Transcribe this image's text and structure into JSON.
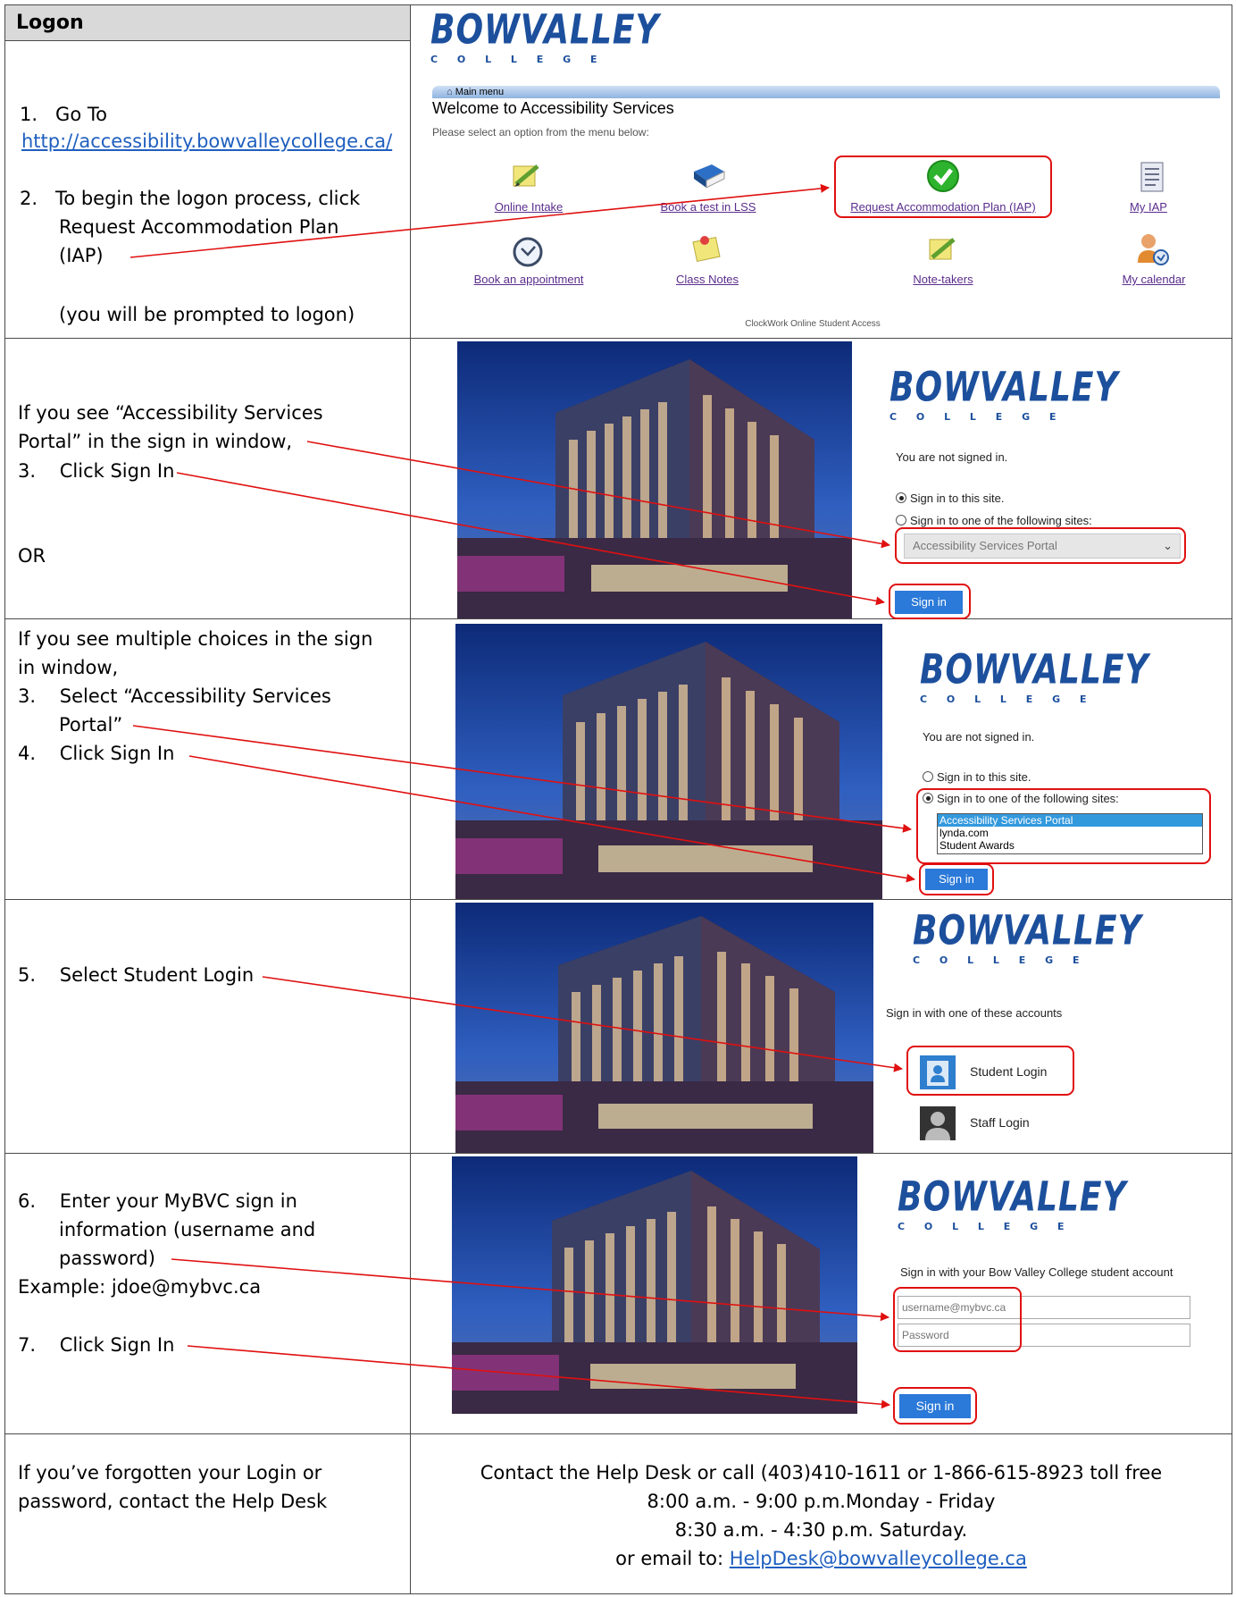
{
  "header": {
    "title": "Logon"
  },
  "logo": {
    "main": "BOWVALLEY",
    "sub": "C O L L E G E"
  },
  "row1": {
    "step1_label": "1.   Go To",
    "step1_link": "http://accessibility.bowvalleycollege.ca/",
    "step2_line1": "2.   To begin the logon process, click",
    "step2_line2": "Request Accommodation Plan",
    "step2_line3": "(IAP)",
    "prompt_note": "(you will be prompted to  logon)"
  },
  "clockwork": {
    "menu_tab": "Main menu",
    "heading": "Welcome to Accessibility Services",
    "subtitle": "Please select an option from the menu below:",
    "items": [
      {
        "label": "Online Intake",
        "icon": "pencil-note-icon"
      },
      {
        "label": "Book a test in LSS",
        "icon": "book-icon"
      },
      {
        "label": "Request Accommodation Plan (IAP)",
        "icon": "green-check-icon"
      },
      {
        "label": "My IAP",
        "icon": "document-icon"
      },
      {
        "label": "Book an appointment",
        "icon": "clock-icon"
      },
      {
        "label": "Class Notes",
        "icon": "notes-pin-icon"
      },
      {
        "label": "Note-takers",
        "icon": "pencil-note-icon"
      },
      {
        "label": "My calendar",
        "icon": "person-calendar-icon"
      }
    ],
    "footer": "ClockWork Online Student Access"
  },
  "row2": {
    "line1": "If you see “Accessibility Services",
    "line2": "Portal” in the sign in window,",
    "line3": "3.    Click Sign In",
    "or": "OR",
    "not_signed": "You are not signed in.",
    "opt1": "Sign in to this site.",
    "opt2": "Sign in to one of the following sites:",
    "select_value": "Accessibility Services Portal",
    "button": "Sign in"
  },
  "row3": {
    "line1": "If you see multiple choices in the sign",
    "line2": "in window,",
    "line3": "3.    Select “Accessibility Services",
    "line4": "Portal”",
    "line5": "4.    Click Sign In",
    "not_signed": "You are not signed in.",
    "opt1": "Sign in to this site.",
    "opt2": "Sign in to one of the following sites:",
    "list": [
      "Accessibility Services Portal",
      "lynda.com",
      "Student Awards"
    ],
    "button": "Sign in"
  },
  "row4": {
    "line1": "5.    Select Student Login",
    "prompt": "Sign in with one of these accounts",
    "student": "Student Login",
    "staff": "Staff Login"
  },
  "row5": {
    "line1": "6.    Enter your MyBVC sign in",
    "line2": "information (username and",
    "line3": "password)",
    "example": "Example: jdoe@mybvc.ca",
    "line4": "7.    Click Sign In",
    "prompt": "Sign in with your Bow Valley College student account",
    "user_placeholder": "username@mybvc.ca",
    "pass_placeholder": "Password",
    "button": "Sign in"
  },
  "row6": {
    "left1": "If you’ve forgotten your Login or",
    "left2": "password, contact the Help Desk",
    "right1": "Contact the Help Desk or call (403)410-1611 or 1-866-615-8923 toll free",
    "right2": "8:00 a.m. - 9:00 p.m.Monday - Friday",
    "right3": "8:30 a.m. - 4:30 p.m. Saturday.",
    "right4": "or email to: ",
    "email": "HelpDesk@bowvalleycollege.ca"
  },
  "colors": {
    "header_bg": "#d9d9d9",
    "annotation_red": "#e01010",
    "bvc_blue": "#1c4f9c",
    "link_blue": "#1f5fbf",
    "button_blue": "#2b79d8"
  }
}
